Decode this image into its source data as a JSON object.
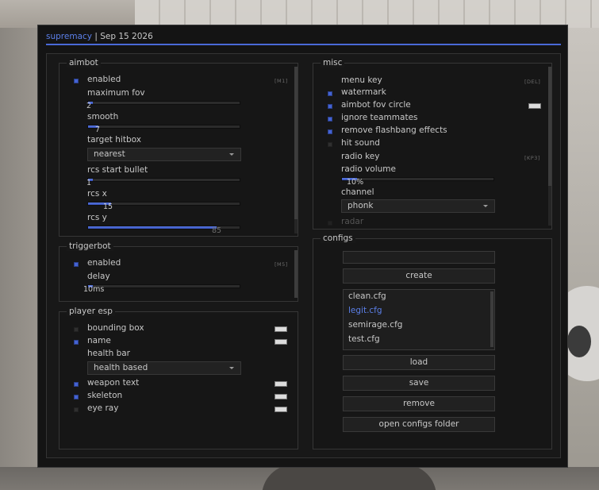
{
  "title": {
    "brand": "supremacy",
    "separator": "|",
    "date": "Sep 15 2026"
  },
  "colors": {
    "accent": "#4a6ad8",
    "accent_text": "#5b7fe8",
    "panel": "#181818"
  },
  "aimbot": {
    "title": "aimbot",
    "enabled": {
      "label": "enabled",
      "checked": true,
      "key": "[M1]"
    },
    "maximum_fov": {
      "label": "maximum fov",
      "value": "2",
      "fraction": 0.0
    },
    "smooth": {
      "label": "smooth",
      "value": "7",
      "fraction": 0.07
    },
    "target_hitbox": {
      "label": "target hitbox",
      "selected": "nearest"
    },
    "rcs_start_bullet": {
      "label": "rcs start bullet",
      "value": "1",
      "fraction": 0.0
    },
    "rcs_x": {
      "label": "rcs x",
      "value": "15",
      "fraction": 0.15
    },
    "rcs_y": {
      "label": "rcs y",
      "value": "85",
      "fraction": 0.85
    }
  },
  "triggerbot": {
    "title": "triggerbot",
    "enabled": {
      "label": "enabled",
      "checked": true,
      "key": "[M5]"
    },
    "delay": {
      "label": "delay",
      "value": "10ms",
      "fraction": 0.03
    }
  },
  "player_esp": {
    "title": "player esp",
    "bounding_box": {
      "label": "bounding box",
      "checked": false
    },
    "name": {
      "label": "name",
      "checked": true
    },
    "health_bar": {
      "label": "health bar",
      "selected": "health based"
    },
    "weapon_text": {
      "label": "weapon text",
      "checked": true
    },
    "skeleton": {
      "label": "skeleton",
      "checked": true
    },
    "eye_ray": {
      "label": "eye ray",
      "checked": false
    }
  },
  "misc": {
    "title": "misc",
    "menu_key": {
      "label": "menu key",
      "key": "[DEL]"
    },
    "watermark": {
      "label": "watermark",
      "checked": true
    },
    "aimbot_fov_circle": {
      "label": "aimbot fov circle",
      "checked": true
    },
    "ignore_teammates": {
      "label": "ignore teammates",
      "checked": true
    },
    "remove_flashbang": {
      "label": "remove flashbang effects",
      "checked": true
    },
    "hit_sound": {
      "label": "hit sound",
      "checked": false
    },
    "radio_key": {
      "label": "radio key",
      "key": "[KP3]"
    },
    "radio_volume": {
      "label": "radio volume",
      "value": "10%",
      "fraction": 0.1
    },
    "channel": {
      "label": "channel",
      "selected": "phonk"
    },
    "radar": {
      "label": "radar",
      "checked": false
    }
  },
  "configs": {
    "title": "configs",
    "name_input": "",
    "create_label": "create",
    "files": [
      "clean.cfg",
      "legit.cfg",
      "semirage.cfg",
      "test.cfg"
    ],
    "selected_file": "legit.cfg",
    "load_label": "load",
    "save_label": "save",
    "remove_label": "remove",
    "open_folder_label": "open configs folder"
  }
}
